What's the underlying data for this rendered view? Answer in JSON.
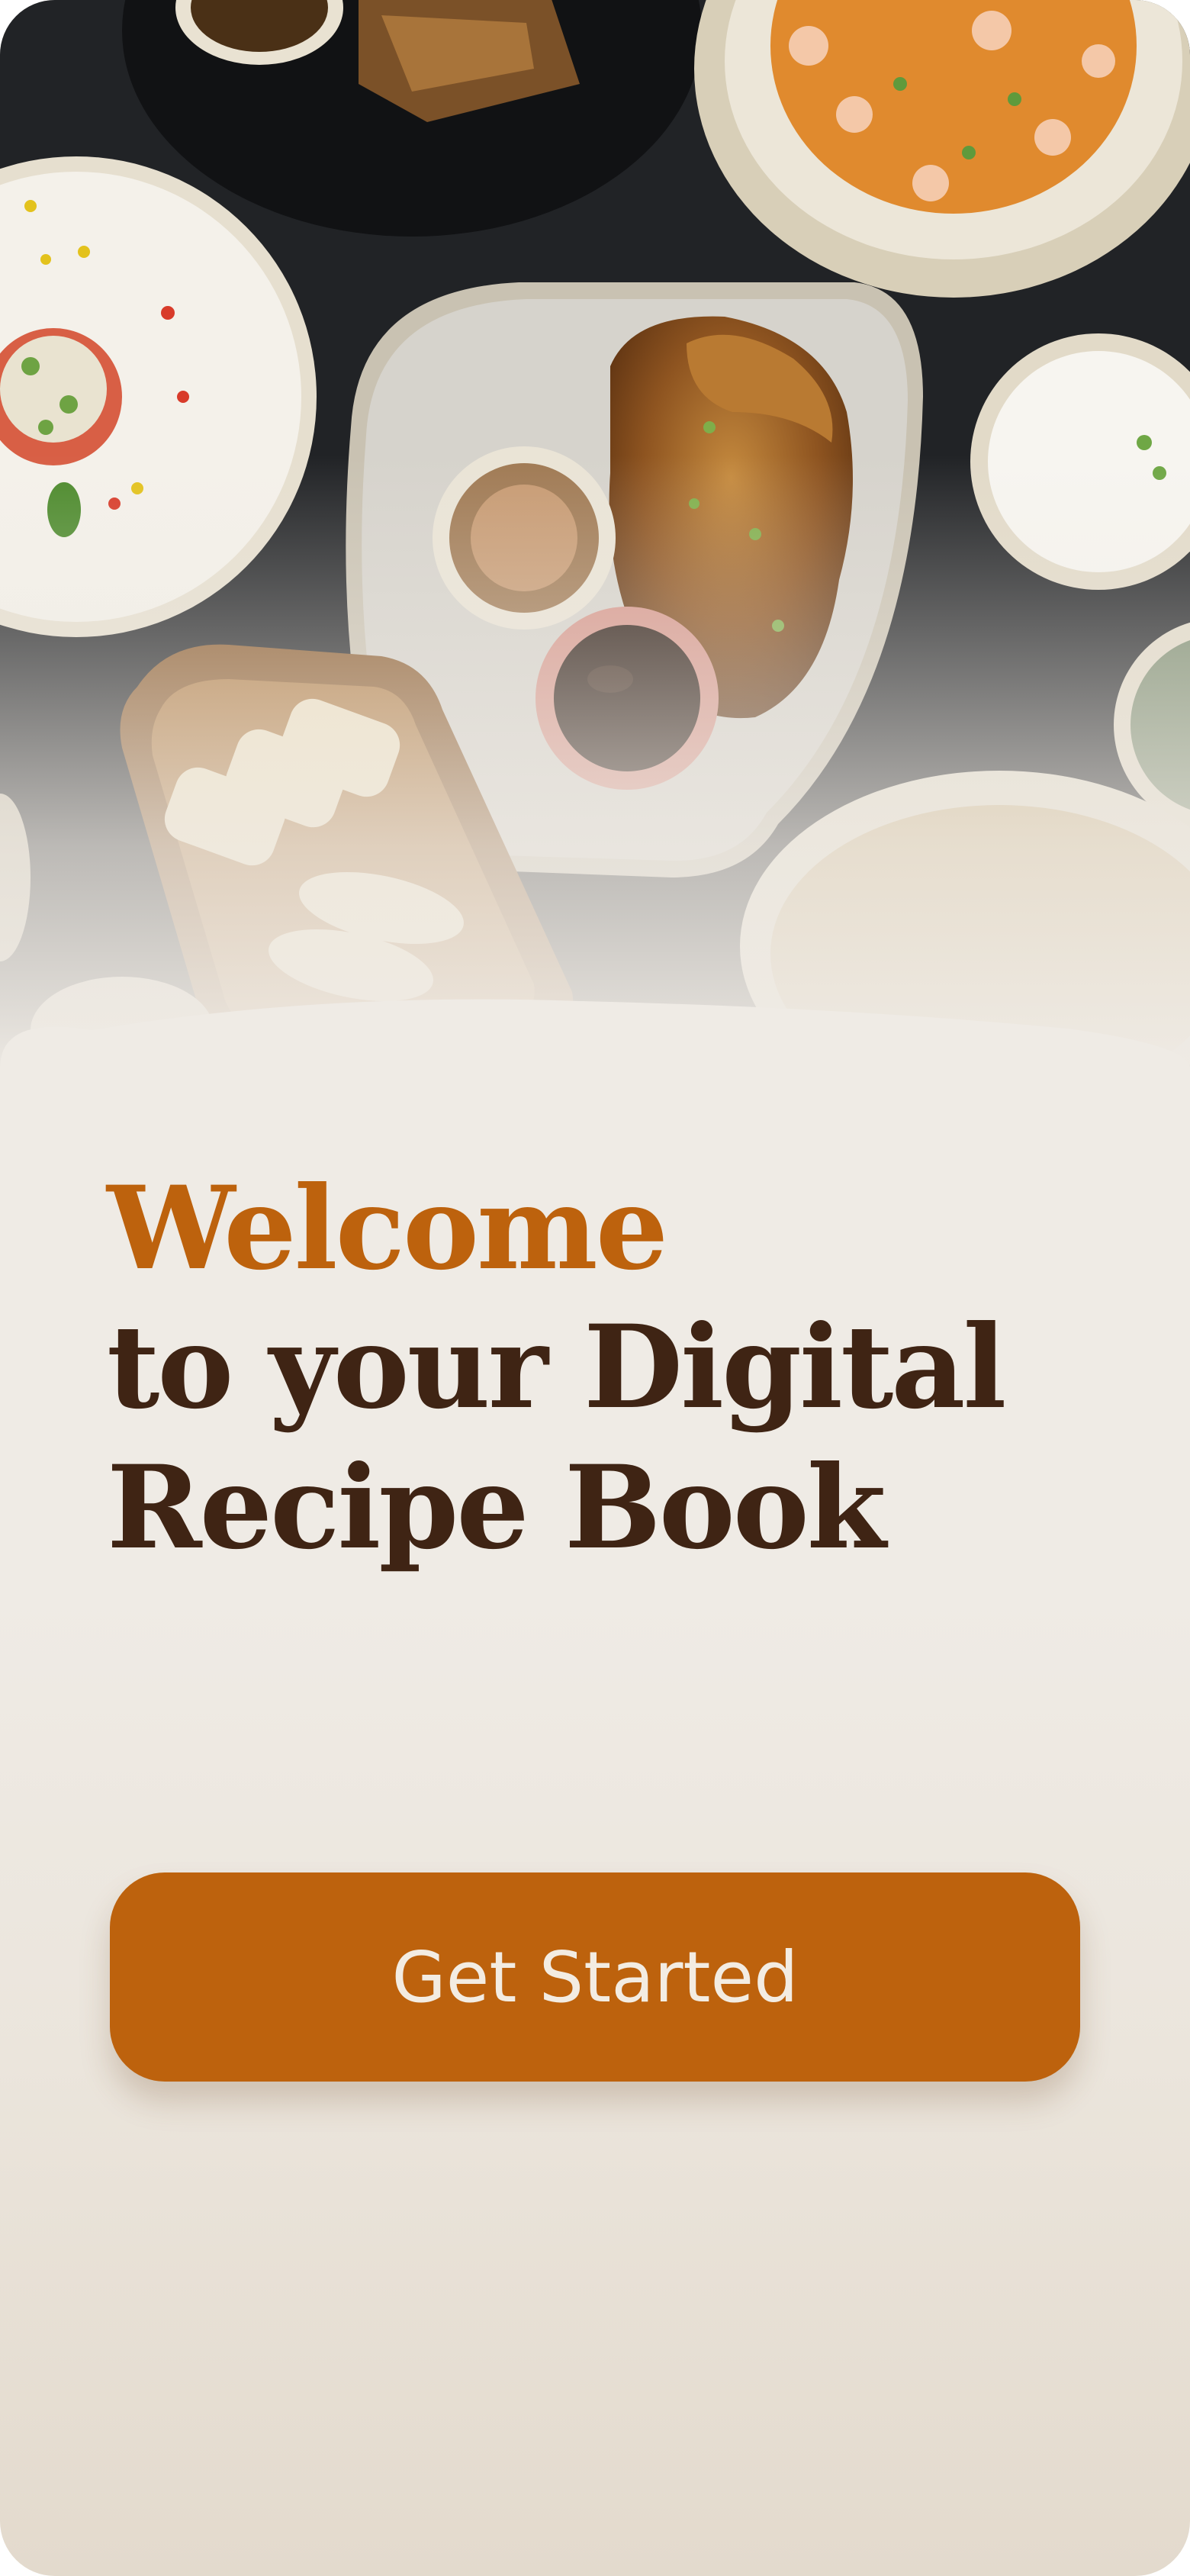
{
  "welcome": {
    "accent_line": "Welcome",
    "line_2": "to your Digital",
    "line_3": "Recipe Book"
  },
  "cta": {
    "label": "Get Started"
  },
  "hero": {
    "image": "food-spread-photo"
  },
  "colors": {
    "accent": "#bd620d",
    "heading_dark": "#3f2414",
    "background": "#efebe5",
    "button_text": "#f3ece2"
  }
}
